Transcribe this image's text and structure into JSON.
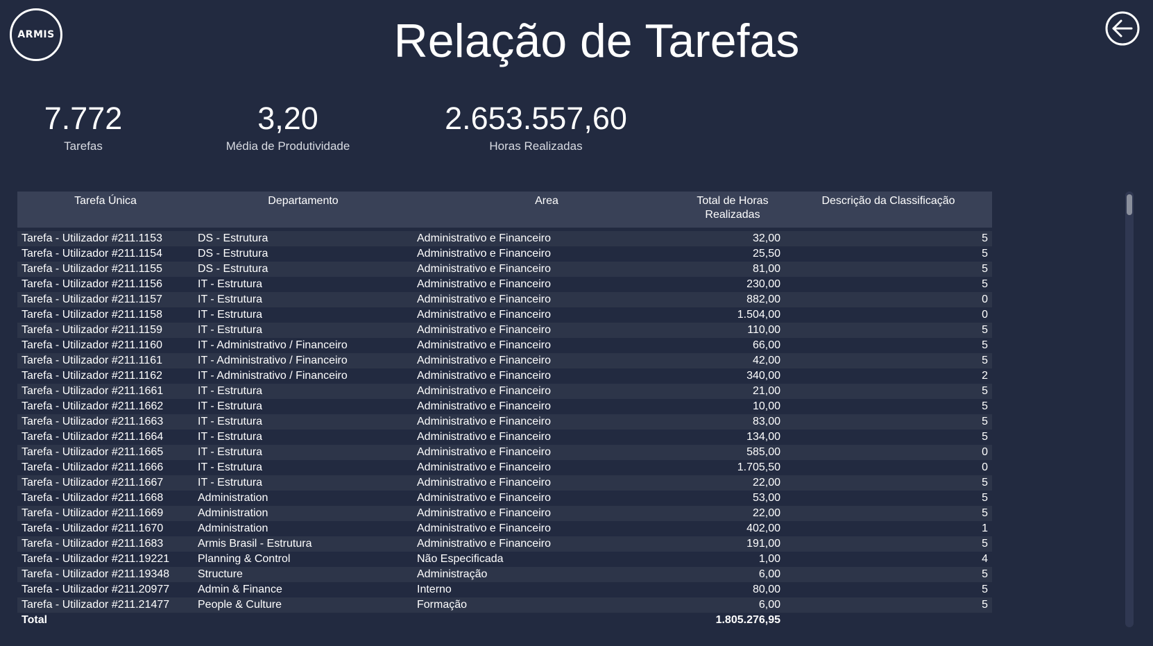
{
  "header": {
    "logo_text": "ARMIS",
    "title": "Relação de Tarefas",
    "back_icon": "arrow-left-circle-icon"
  },
  "kpis": [
    {
      "value": "7.772",
      "label": "Tarefas"
    },
    {
      "value": "3,20",
      "label": "Média de Produtividade"
    },
    {
      "value": "2.653.557,60",
      "label": "Horas Realizadas"
    }
  ],
  "table": {
    "headers": [
      "Tarefa Única",
      "Departamento",
      "Area",
      "Total de Horas Realizadas",
      "Descrição da Classificação"
    ],
    "rows": [
      [
        "Tarefa - Utilizador #211.1153",
        "DS - Estrutura",
        "Administrativo e Financeiro",
        "32,00",
        "5"
      ],
      [
        "Tarefa - Utilizador #211.1154",
        "DS - Estrutura",
        "Administrativo e Financeiro",
        "25,50",
        "5"
      ],
      [
        "Tarefa - Utilizador #211.1155",
        "DS - Estrutura",
        "Administrativo e Financeiro",
        "81,00",
        "5"
      ],
      [
        "Tarefa - Utilizador #211.1156",
        "IT - Estrutura",
        "Administrativo e Financeiro",
        "230,00",
        "5"
      ],
      [
        "Tarefa - Utilizador #211.1157",
        "IT - Estrutura",
        "Administrativo e Financeiro",
        "882,00",
        "0"
      ],
      [
        "Tarefa - Utilizador #211.1158",
        "IT - Estrutura",
        "Administrativo e Financeiro",
        "1.504,00",
        "0"
      ],
      [
        "Tarefa - Utilizador #211.1159",
        "IT - Estrutura",
        "Administrativo e Financeiro",
        "110,00",
        "5"
      ],
      [
        "Tarefa - Utilizador #211.1160",
        "IT - Administrativo / Financeiro",
        "Administrativo e Financeiro",
        "66,00",
        "5"
      ],
      [
        "Tarefa - Utilizador #211.1161",
        "IT - Administrativo / Financeiro",
        "Administrativo e Financeiro",
        "42,00",
        "5"
      ],
      [
        "Tarefa - Utilizador #211.1162",
        "IT - Administrativo / Financeiro",
        "Administrativo e Financeiro",
        "340,00",
        "2"
      ],
      [
        "Tarefa - Utilizador #211.1661",
        "IT - Estrutura",
        "Administrativo e Financeiro",
        "21,00",
        "5"
      ],
      [
        "Tarefa - Utilizador #211.1662",
        "IT - Estrutura",
        "Administrativo e Financeiro",
        "10,00",
        "5"
      ],
      [
        "Tarefa - Utilizador #211.1663",
        "IT - Estrutura",
        "Administrativo e Financeiro",
        "83,00",
        "5"
      ],
      [
        "Tarefa - Utilizador #211.1664",
        "IT - Estrutura",
        "Administrativo e Financeiro",
        "134,00",
        "5"
      ],
      [
        "Tarefa - Utilizador #211.1665",
        "IT - Estrutura",
        "Administrativo e Financeiro",
        "585,00",
        "0"
      ],
      [
        "Tarefa - Utilizador #211.1666",
        "IT - Estrutura",
        "Administrativo e Financeiro",
        "1.705,50",
        "0"
      ],
      [
        "Tarefa - Utilizador #211.1667",
        "IT - Estrutura",
        "Administrativo e Financeiro",
        "22,00",
        "5"
      ],
      [
        "Tarefa - Utilizador #211.1668",
        "Administration",
        "Administrativo e Financeiro",
        "53,00",
        "5"
      ],
      [
        "Tarefa - Utilizador #211.1669",
        "Administration",
        "Administrativo e Financeiro",
        "22,00",
        "5"
      ],
      [
        "Tarefa - Utilizador #211.1670",
        "Administration",
        "Administrativo e Financeiro",
        "402,00",
        "1"
      ],
      [
        "Tarefa - Utilizador #211.1683",
        "Armis Brasil - Estrutura",
        "Administrativo e Financeiro",
        "191,00",
        "5"
      ],
      [
        "Tarefa - Utilizador #211.19221",
        "Planning & Control",
        "Não Especificada",
        "1,00",
        "4"
      ],
      [
        "Tarefa - Utilizador #211.19348",
        "Structure",
        "Administração",
        "6,00",
        "5"
      ],
      [
        "Tarefa - Utilizador #211.20977",
        "Admin & Finance",
        "Interno",
        "80,00",
        "5"
      ],
      [
        "Tarefa - Utilizador #211.21477",
        "People & Culture",
        "Formação",
        "6,00",
        "5"
      ]
    ],
    "total": {
      "label": "Total",
      "hours": "1.805.276,95"
    }
  }
}
